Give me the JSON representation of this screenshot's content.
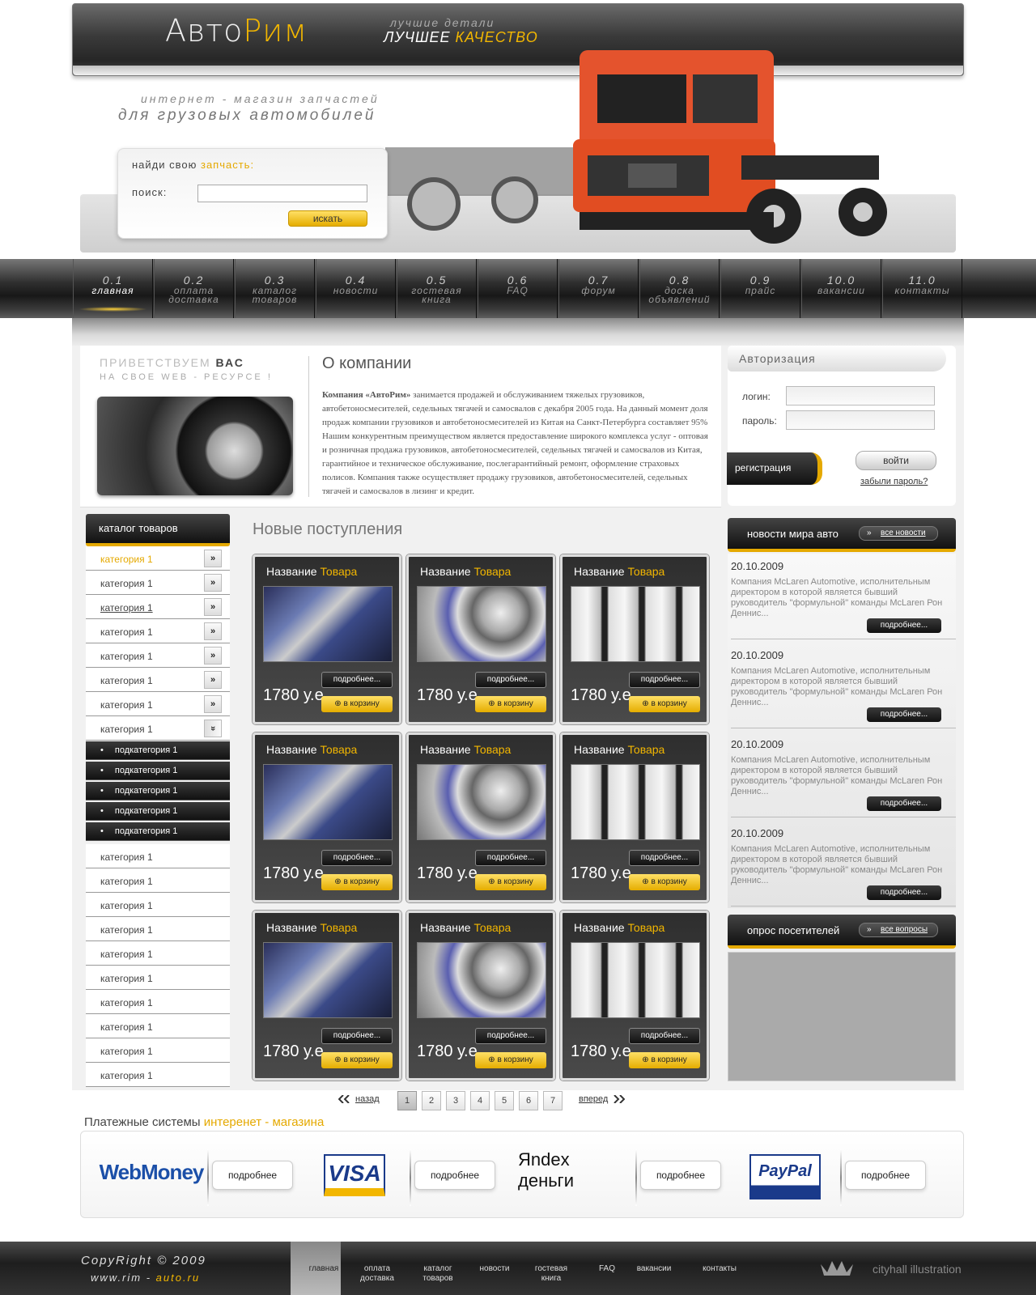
{
  "header": {
    "logo_part1": "Авто",
    "logo_part2": "Рим",
    "slogan_line1": "лучшие детали",
    "slogan_line2_white": "ЛУЧШЕЕ ",
    "slogan_line2_yellow": "КАЧЕСТВО",
    "tagline_line1": "интернет - магазин запчастей",
    "tagline_line2": "для грузовых автомобилей"
  },
  "search": {
    "title_white": "найди свою ",
    "title_yellow": "запчасть:",
    "label": "поиск:",
    "value": "",
    "button": "искать"
  },
  "nav": [
    {
      "num": "0.1",
      "label": "главная",
      "active": true
    },
    {
      "num": "0.2",
      "label": "оплата доставка"
    },
    {
      "num": "0.3",
      "label": "каталог товаров"
    },
    {
      "num": "0.4",
      "label": "новости"
    },
    {
      "num": "0.5",
      "label": "гостевая книга"
    },
    {
      "num": "0.6",
      "label": "FAQ"
    },
    {
      "num": "0.7",
      "label": "форум"
    },
    {
      "num": "0.8",
      "label": "доска объявлений"
    },
    {
      "num": "0.9",
      "label": "прайс"
    },
    {
      "num": "10.0",
      "label": "вакансии"
    },
    {
      "num": "11.0",
      "label": "контакты"
    }
  ],
  "welcome": {
    "line1_light": "ПРИВЕТСТВУЕМ ",
    "line1_dark": "ВАС",
    "line2": "НА СВОЕ WEB - РЕСУРСЕ !"
  },
  "about": {
    "title": "О компании",
    "company": "Компания «АвтоРим»",
    "text": " занимается продажей и обслуживанием тяжелых грузовиков, автобетоносмесителей, седельных тягачей и самосвалов с декабря 2005 года. На данный момент доля продаж компании грузовиков и автобетоносмесителей из Китая на Санкт-Петербурга составляет 95% Нашим конкурентным преимуществом является предоставление широкого комплекса услуг - оптовая и розничная продажа  грузовиков, автобетоносмесителей, седельных тягачей и самосвалов из Китая, гарантийное и техническое обслуживание, послегарантийный ремонт, оформление страховых полисов. Компания также осуществляет продажу грузовиков, автобетоносмесителей, седельных тягачей и самосвалов в лизинг и кредит."
  },
  "catalog": {
    "title": "каталог товаров",
    "rows_top": [
      "категория 1",
      "категория 1",
      "категория 1",
      "категория 1",
      "категория 1",
      "категория 1",
      "категория 1",
      "категория 1"
    ],
    "subcategories": [
      "подкатегория 1",
      "подкатегория 1",
      "подкатегория 1",
      "подкатегория 1",
      "подкатегория 1"
    ],
    "rows_bottom": [
      "категория 1",
      "категория 1",
      "категория 1",
      "категория 1",
      "категория 1",
      "категория 1",
      "категория 1",
      "категория 1",
      "категория 1",
      "категория 1"
    ],
    "arrow": "»",
    "arrow_open": "»"
  },
  "products": {
    "title": "Новые поступления",
    "name_white": "Название ",
    "name_yellow": "Товара",
    "price": "1780 у.е",
    "more": "подробнее...",
    "cart": "в корзину",
    "images": [
      "engine",
      "filter",
      "tank",
      "engine",
      "filter",
      "tank",
      "engine",
      "filter",
      "tank"
    ]
  },
  "pager": {
    "prev": "назад",
    "next": "вперед",
    "pages": [
      "1",
      "2",
      "3",
      "4",
      "5",
      "6",
      "7"
    ],
    "current": "1"
  },
  "auth": {
    "title": "Авторизация",
    "login_label": "логин:",
    "password_label": "пароль:",
    "login_value": "",
    "password_value": "",
    "register": "регистрация",
    "login_button": "войти",
    "forgot": "забыли пароль?"
  },
  "news": {
    "title": "новости мира авто",
    "all": "все новости",
    "items": [
      {
        "date": "20.10.2009",
        "text": "Компания McLaren Automotive, исполнительным директором в которой является бывший руководитель \"формульной\" команды McLaren Рон Деннис...",
        "more": "подробнее..."
      },
      {
        "date": "20.10.2009",
        "text": "Компания McLaren Automotive, исполнительным директором в которой является бывший руководитель \"формульной\" команды McLaren Рон Деннис...",
        "more": "подробнее..."
      },
      {
        "date": "20.10.2009",
        "text": "Компания McLaren Automotive, исполнительным директором в которой является бывший руководитель \"формульной\" команды McLaren Рон Деннис...",
        "more": "подробнее..."
      },
      {
        "date": "20.10.2009",
        "text": "Компания McLaren Automotive, исполнительным директором в которой является бывший руководитель \"формульной\" команды McLaren Рон Деннис...",
        "more": "подробнее..."
      }
    ]
  },
  "poll": {
    "title": "опрос посетителей",
    "all": "все вопросы"
  },
  "payment": {
    "title_dark": "Платежные системы ",
    "title_yellow": "интеренет - магазина",
    "more": "подробнее",
    "systems": [
      "WebMoney",
      "VISA",
      "Яndex деньги",
      "PayPal"
    ]
  },
  "footer": {
    "copyright": "CopyRight  ©  2009",
    "site_white": "www.rim - ",
    "site_yellow": "auto.ru",
    "nav": [
      "главная",
      "оплата доставка",
      "каталог товаров",
      "новости",
      "гостевая книга",
      "FAQ",
      "вакансии",
      "контакты"
    ],
    "credit": "cityhall illustration"
  },
  "colors": {
    "accent": "#f2b600",
    "dark": "#1e1e1e"
  }
}
